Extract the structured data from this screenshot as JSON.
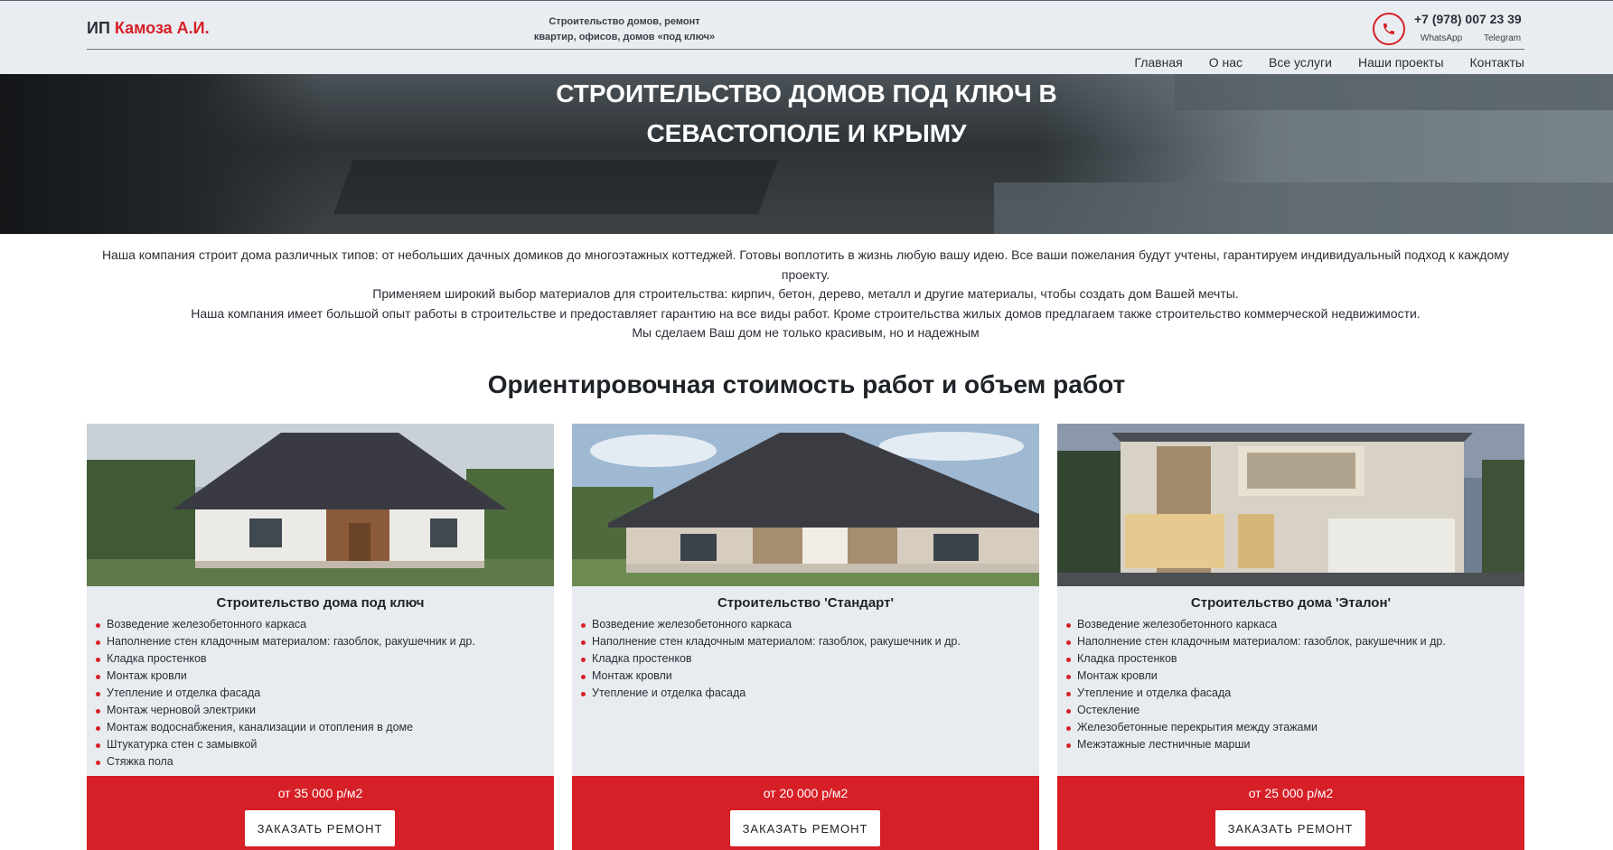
{
  "header": {
    "logo_prefix": "ИП",
    "logo_name": "Камоза А.И.",
    "tagline_line1": "Строительство домов, ремонт",
    "tagline_line2": "квартир, офисов, домов «под ключ»",
    "phone": "+7 (978) 007 23 39",
    "messenger_1": "WhatsApp",
    "messenger_2": "Telegram",
    "phone_icon": "phone-icon",
    "nav": [
      "Главная",
      "О нас",
      "Все услуги",
      "Наши проекты",
      "Контакты"
    ]
  },
  "hero": {
    "title_line1": "СТРОИТЕЛЬСТВО ДОМОВ ПОД КЛЮЧ В",
    "title_line2": "СЕВАСТОПОЛЕ И КРЫМУ"
  },
  "intro": [
    "Наша компания строит дома различных типов: от небольших дачных домиков до многоэтажных коттеджей. Готовы воплотить в жизнь любую вашу идею. Все ваши пожелания будут учтены, гарантируем индивидуальный подход к каждому проекту.",
    "Применяем широкий выбор материалов для строительства: кирпич, бетон, дерево, металл и другие материалы, чтобы создать дом Вашей мечты.",
    "Наша компания имеет большой опыт работы в строительстве и предоставляет гарантию на все виды работ. Кроме строительства жилых домов предлагаем также строительство коммерческой недвижимости.",
    "Мы сделаем Ваш дом не только красивым, но и надежным"
  ],
  "section_title": "Ориентировочная стоимость работ и объем работ",
  "colors": {
    "accent": "#d61f26",
    "header_bg": "#e9edf2",
    "card_bg": "#e8ebf0"
  },
  "cards": [
    {
      "title": "Строительство дома под ключ",
      "items": [
        "Возведение железобетонного каркаса",
        "Наполнение стен кладочным материалом: газоблок, ракушечник и др.",
        "Кладка простенков",
        "Монтаж кровли",
        "Утепление и отделка фасада",
        "Монтаж черновой электрики",
        "Монтаж водоснабжения, канализации и отопления в доме",
        "Штукатурка стен с замывкой",
        "Стяжка пола"
      ],
      "price": "от 35 000 р/м2",
      "button": "ЗАКАЗАТЬ РЕМОНТ"
    },
    {
      "title": "Строительство 'Стандарт'",
      "items": [
        "Возведение железобетонного каркаса",
        "Наполнение стен кладочным материалом: газоблок, ракушечник и др.",
        "Кладка простенков",
        "Монтаж кровли",
        "Утепление и отделка фасада"
      ],
      "price": "от 20 000 р/м2",
      "button": "ЗАКАЗАТЬ РЕМОНТ"
    },
    {
      "title": "Строительство дома 'Эталон'",
      "items": [
        "Возведение железобетонного каркаса",
        "Наполнение стен кладочным материалом: газоблок, ракушечник и др.",
        "Кладка простенков",
        "Монтаж кровли",
        "Утепление и отделка фасада",
        "Остекление",
        "Железобетонные перекрытия между этажами",
        "Межэтажные лестничные марши"
      ],
      "price": "от 25 000 р/м2",
      "button": "ЗАКАЗАТЬ РЕМОНТ"
    }
  ]
}
